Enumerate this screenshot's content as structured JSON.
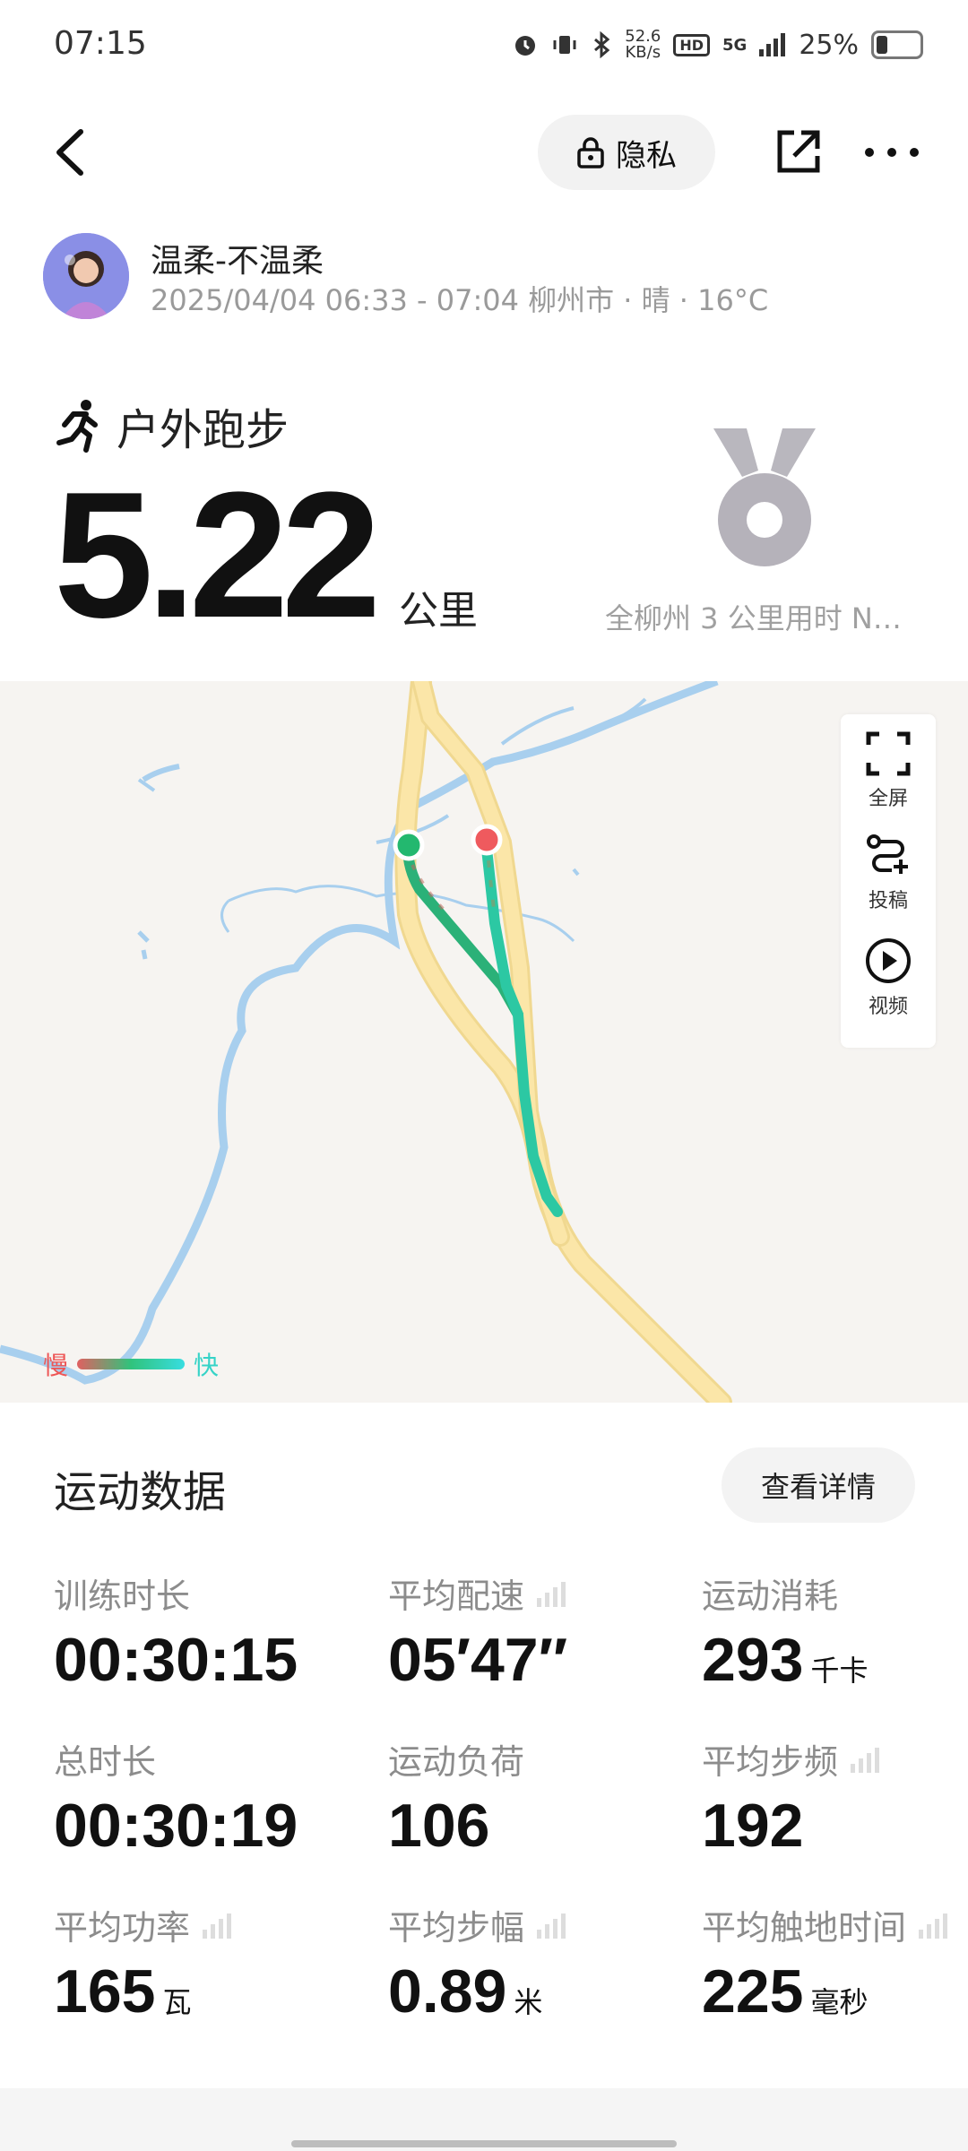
{
  "status_bar": {
    "time": "07:15",
    "net_speed_value": "52.6",
    "net_speed_unit": "KB/s",
    "hd": "HD",
    "signal": "5G",
    "battery": "25%"
  },
  "topbar": {
    "privacy_label": "隐私"
  },
  "profile": {
    "name": "温柔-不温柔",
    "meta": "2025/04/04 06:33 - 07:04 柳州市 · 晴 · 16°C"
  },
  "workout": {
    "type": "户外跑步",
    "distance": "5.22",
    "unit": "公里",
    "medal_text": "全柳州 3 公里用时 N…"
  },
  "map": {
    "tools": [
      {
        "label": "全屏",
        "icon": "fullscreen-icon"
      },
      {
        "label": "投稿",
        "icon": "route-submit-icon"
      },
      {
        "label": "视频",
        "icon": "play-video-icon"
      }
    ],
    "legend": {
      "slow": "慢",
      "fast": "快"
    }
  },
  "stats": {
    "title": "运动数据",
    "detail_button": "查看详情",
    "items": [
      {
        "label": "训练时长",
        "value": "00:30:15",
        "unit": ""
      },
      {
        "label": "平均配速",
        "value": "05′47″",
        "unit": ""
      },
      {
        "label": "运动消耗",
        "value": "293",
        "unit": "千卡"
      },
      {
        "label": "总时长",
        "value": "00:30:19",
        "unit": ""
      },
      {
        "label": "运动负荷",
        "value": "106",
        "unit": ""
      },
      {
        "label": "平均步频",
        "value": "192",
        "unit": ""
      },
      {
        "label": "平均功率",
        "value": "165",
        "unit": "瓦"
      },
      {
        "label": "平均步幅",
        "value": "0.89",
        "unit": "米"
      },
      {
        "label": "平均触地时间",
        "value": "225",
        "unit": "毫秒"
      }
    ]
  },
  "colors": {
    "route_start": "#23b86f",
    "route_end": "#ef5a5e",
    "road": "#fbe6a8",
    "river": "#a8cfee"
  }
}
